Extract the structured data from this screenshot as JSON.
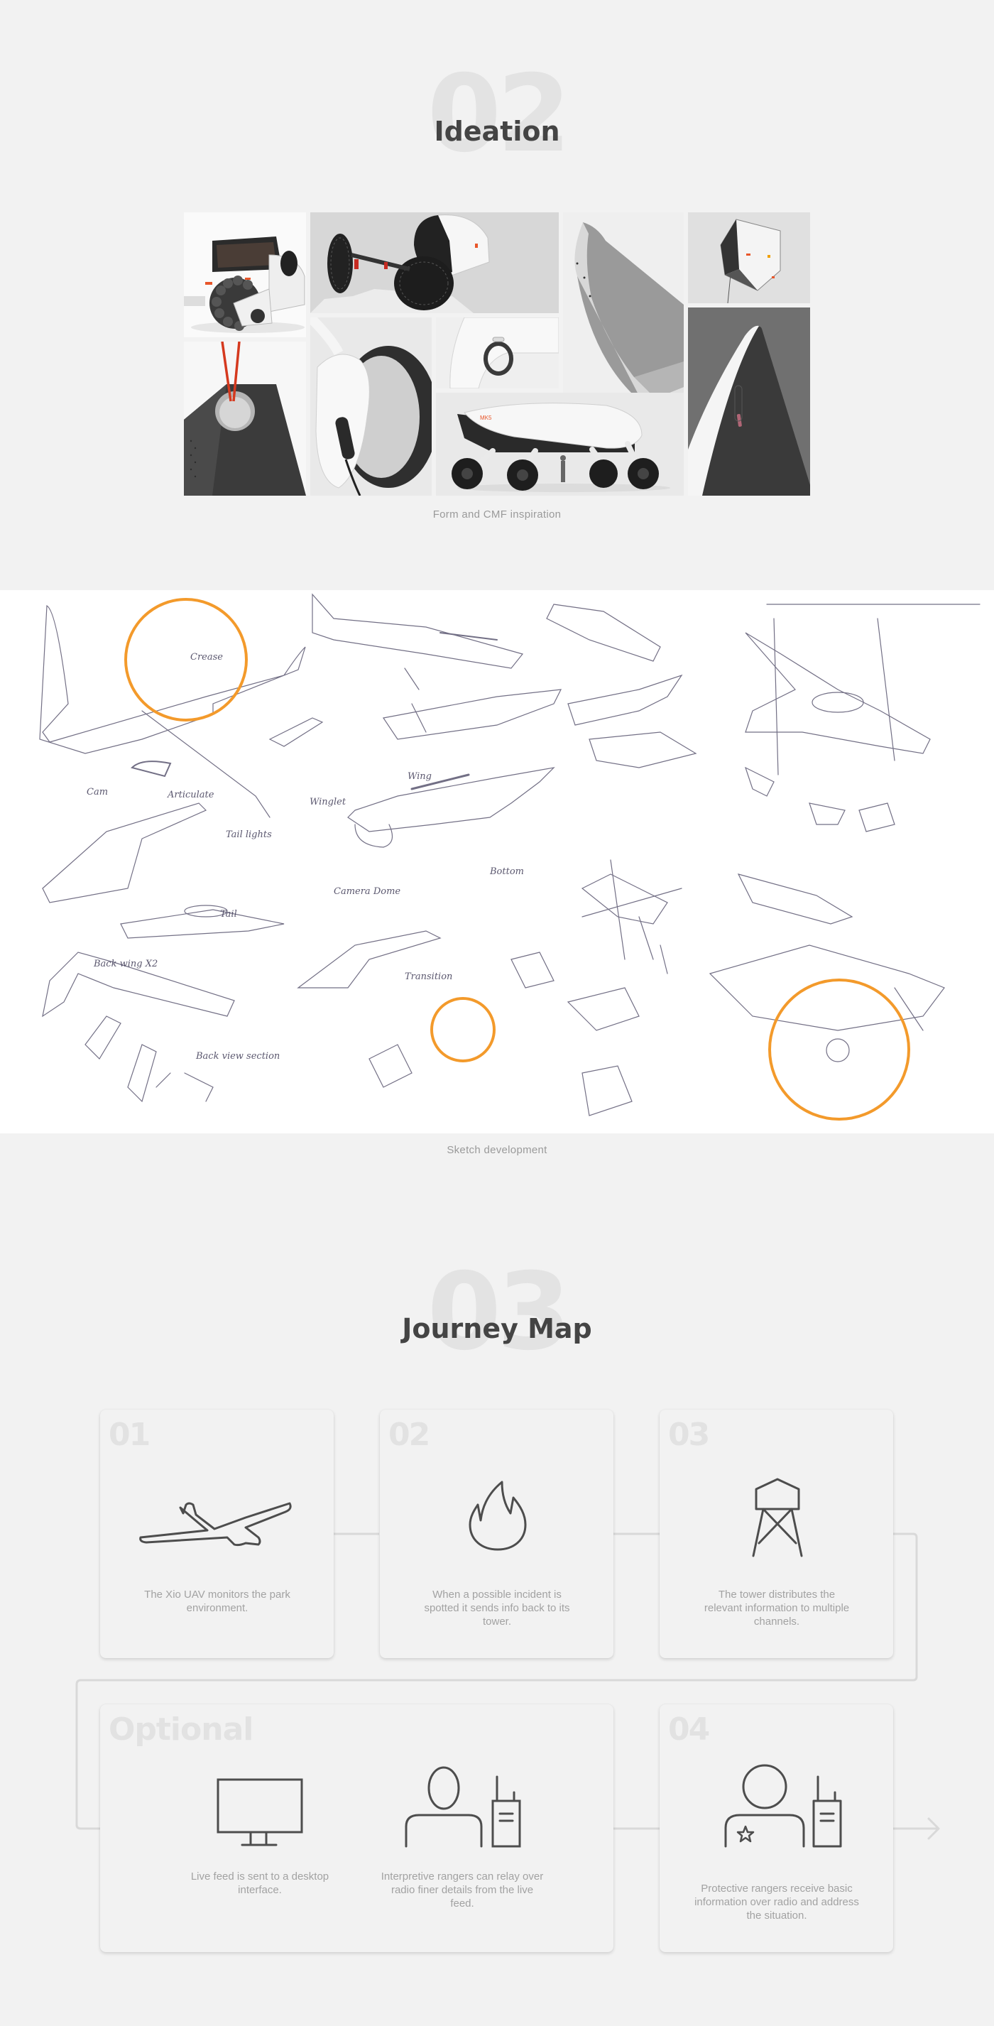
{
  "ideation": {
    "number": "02",
    "title": "Ideation",
    "caption": "Form and CMF inspiration",
    "tiles": [
      {
        "name": "rover-vehicle-image",
        "alt": "White tracked rover vehicle render"
      },
      {
        "name": "wheeled-robot-image",
        "alt": "Black and white robot on rocky terrain"
      },
      {
        "name": "product-handle-image",
        "alt": "Grey and white bent product form"
      },
      {
        "name": "faceted-device-image",
        "alt": "Faceted white hanging device"
      },
      {
        "name": "speaker-strap-image",
        "alt": "Dark speaker with orange strap"
      },
      {
        "name": "headphone-image",
        "alt": "White headphone closeup"
      },
      {
        "name": "trigger-handle-image",
        "alt": "White handle with ring trigger"
      },
      {
        "name": "dark-device-image",
        "alt": "Dark grey device with white edge"
      },
      {
        "name": "mk5-rover-image",
        "alt": "White four-wheeled MK5 rover with human silhouette",
        "badge": "MK5"
      }
    ]
  },
  "sketches": {
    "caption": "Sketch development",
    "labels": [
      "Crease",
      "Cam",
      "Articulate",
      "Tail lights",
      "Winglet",
      "Wing",
      "Bottom",
      "Camera Dome",
      "Tail",
      "Back wing X2",
      "Back view section",
      "Transition"
    ],
    "highlight_color": "#f39a2b"
  },
  "journey": {
    "number": "03",
    "title": "Journey Map",
    "cards": [
      {
        "num": "01",
        "icon": "uav-plane-icon",
        "text": "The Xio UAV monitors the park environment."
      },
      {
        "num": "02",
        "icon": "fire-icon",
        "text": "When a possible incident is spotted it sends info back to its tower."
      },
      {
        "num": "03",
        "icon": "watch-tower-icon",
        "text": "The tower distributes the relevant information to multiple channels."
      }
    ],
    "optional": {
      "label": "Optional",
      "items": [
        {
          "icon": "desktop-monitor-icon",
          "text": "Live feed is sent to a desktop interface."
        },
        {
          "icon": "ranger-radio-icon",
          "text": "Interpretive rangers can relay over radio finer details from the live feed."
        }
      ]
    },
    "final_card": {
      "num": "04",
      "icon": "protective-ranger-radio-icon",
      "text": "Protective rangers receive basic information over radio and address the situation."
    }
  },
  "colors": {
    "background": "#f2f2f2",
    "heading": "#444444",
    "watermark": "#e3e3e3",
    "caption": "#9a9a9a",
    "icon_stroke": "#4d4d4d",
    "accent_orange": "#f39a2b"
  }
}
